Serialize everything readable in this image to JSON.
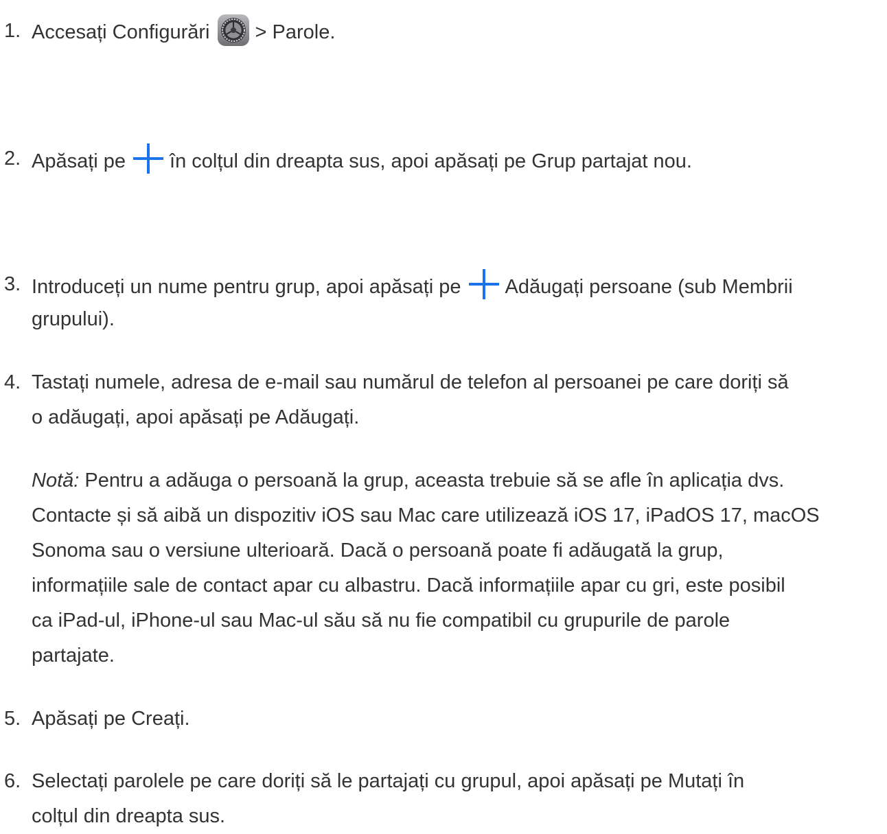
{
  "accent_color": "#1a73e8",
  "steps": [
    {
      "number": "1.",
      "before_icon": "Accesați Configurări",
      "icon": "settings-gear-icon",
      "after_icon": "> Parole."
    },
    {
      "number": "2.",
      "before_icon": "Apăsați pe",
      "icon": "plus-icon",
      "after_icon": "în colțul din dreapta sus, apoi apăsați pe Grup partajat nou."
    },
    {
      "number": "3.",
      "before_icon": "Introduceți un nume pentru grup, apoi apăsați pe",
      "icon": "plus-icon",
      "after_icon": "Adăugați persoane (sub Membrii",
      "line2": "grupului)."
    },
    {
      "number": "4.",
      "lines": [
        "Tastați numele, adresa de e-mail sau numărul de telefon al persoanei pe care doriți să",
        "o adăugați, apoi apăsați pe Adăugați."
      ],
      "note_label": "Notă:",
      "note_lines": [
        " Pentru a adăuga o persoană la grup, aceasta trebuie să se afle în aplicația dvs.",
        "Contacte și să aibă un dispozitiv iOS sau Mac care utilizează iOS 17, iPadOS 17, macOS",
        "Sonoma sau o versiune ulterioară. Dacă o persoană poate fi adăugată la grup,",
        "informațiile sale de contact apar cu albastru. Dacă informațiile apar cu gri, este posibil",
        "ca iPad-ul, iPhone-ul sau Mac-ul său să nu fie compatibil cu grupurile de parole",
        "partajate."
      ]
    },
    {
      "number": "5.",
      "text": "Apăsați pe Creați."
    },
    {
      "number": "6.",
      "lines": [
        "Selectați parolele pe care doriți să le partajați cu grupul, apoi apăsați pe Mutați în",
        "colțul din dreapta sus."
      ]
    }
  ]
}
